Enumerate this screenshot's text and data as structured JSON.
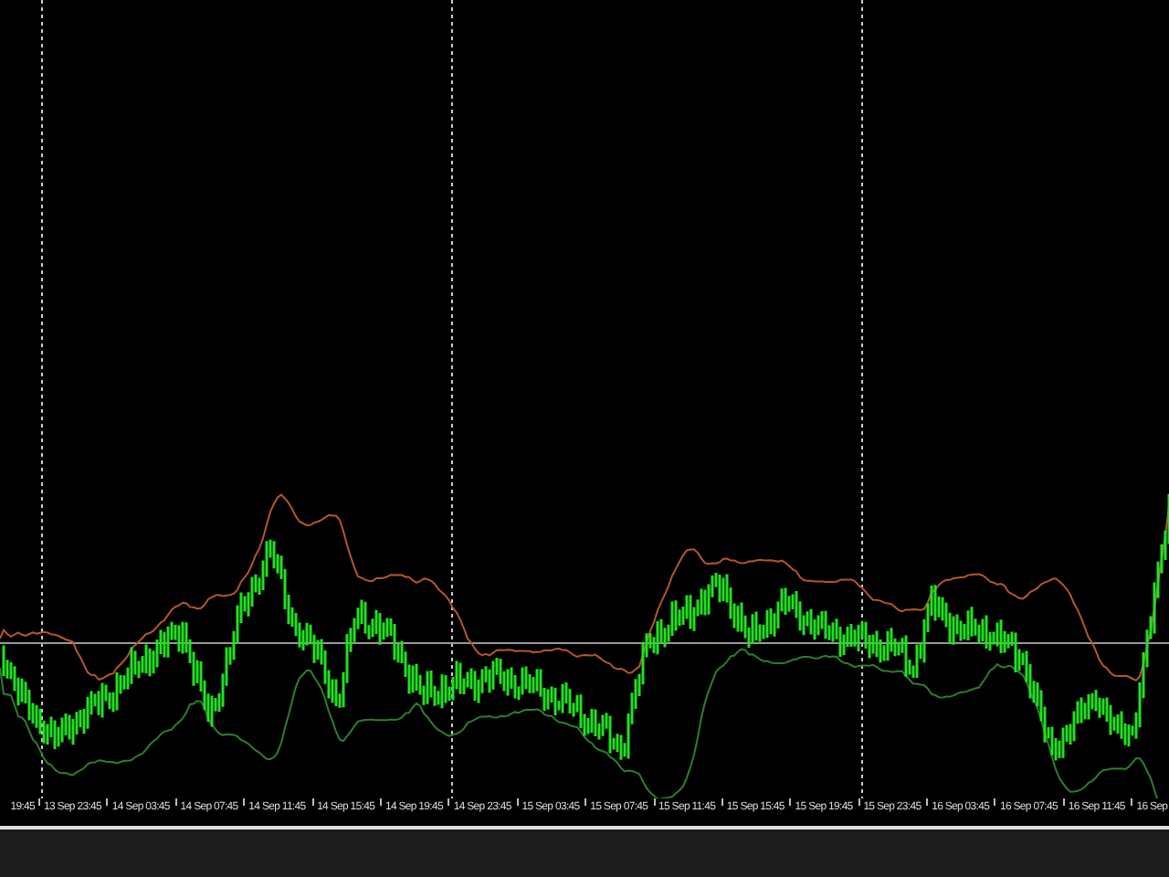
{
  "chart": {
    "time_axis": {
      "labels": [
        "19:45",
        "13 Sep 23:45",
        "14 Sep 03:45",
        "14 Sep 07:45",
        "14 Sep 11:45",
        "14 Sep 15:45",
        "14 Sep 19:45",
        "14 Sep 23:45",
        "15 Sep 03:45",
        "15 Sep 07:45",
        "15 Sep 11:45",
        "15 Sep 15:45",
        "15 Sep 19:45",
        "15 Sep 23:45",
        "16 Sep 03:45",
        "16 Sep 07:45",
        "16 Sep 11:45",
        "16 Sep"
      ]
    }
  }
}
